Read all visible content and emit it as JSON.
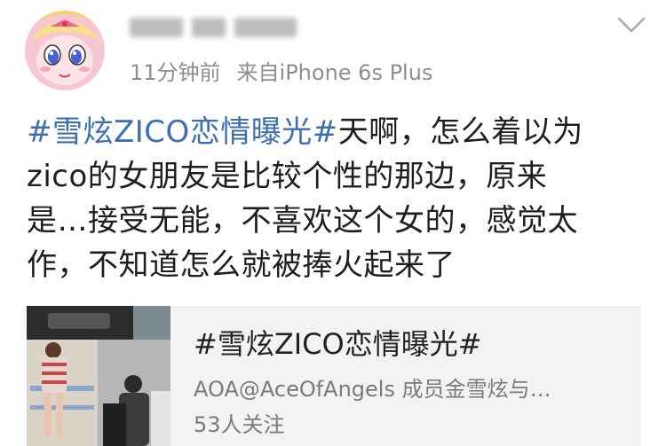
{
  "header": {
    "avatar_icon": "cartoon-avatar-icon",
    "username_blurred": true,
    "time": "11分钟前",
    "source": "来自iPhone 6s Plus",
    "menu_icon": "chevron-down-icon"
  },
  "post": {
    "hashtag": "#雪炫ZICO恋情曝光#",
    "line1_rest": "天啊，怎么着以为",
    "line2": "zico的女朋友是比较个性的那边，原来",
    "line3": "是…接受无能，不喜欢这个女的，感觉太",
    "line4": "作，不知道怎么就被捧火起来了"
  },
  "topic_card": {
    "title": "#雪炫ZICO恋情曝光#",
    "description": "AOA@AceOfAngels 成员金雪炫与…",
    "followers": "53人关注",
    "thumbnail_icon": "photo-thumbnail-icon"
  },
  "colors": {
    "hashtag": "#3d6fb0",
    "meta_text": "#8e8e8e",
    "card_bg": "#f3f3f3"
  }
}
